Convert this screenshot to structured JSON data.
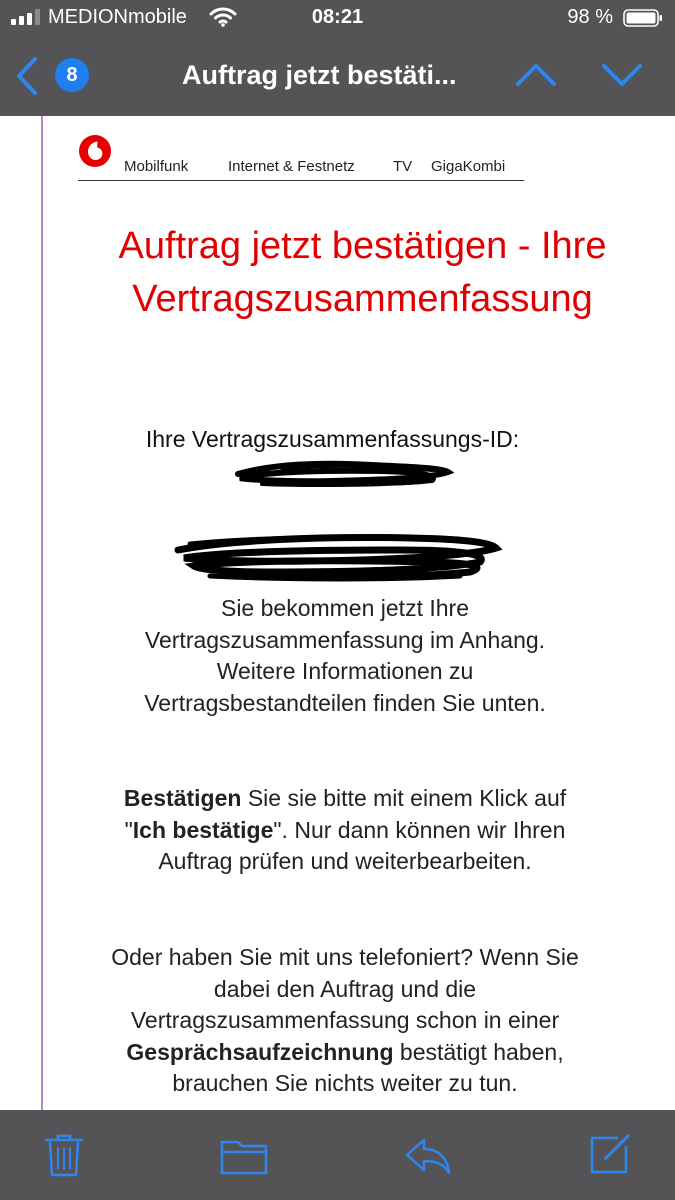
{
  "status_bar": {
    "carrier": "MEDIONmobile",
    "time": "08:21",
    "battery_percent": "98 %"
  },
  "nav": {
    "unread_count": "8",
    "title": "Auftrag jetzt bestäti..."
  },
  "email": {
    "brand_links": [
      "Mobilfunk",
      "Internet & Festnetz",
      "TV",
      "GigaKombi"
    ],
    "headline": "Auftrag jetzt bestätigen - Ihre Vertragszusammenfassung",
    "id_label": "Ihre Vertragszusammenfassungs-ID:",
    "paragraph1": "Sie bekommen jetzt Ihre Vertragszusammenfassung im Anhang. Weitere Informationen zu Vertragsbestandteilen finden Sie unten.",
    "paragraph2": {
      "bold1": "Bestätigen",
      "text1": " Sie sie bitte mit einem Klick auf \"",
      "bold2": "Ich bestätige",
      "text2": "\". Nur dann können wir Ihren Auftrag prüfen und weiterbearbeiten."
    },
    "paragraph3": {
      "text1": "Oder haben Sie mit uns telefoniert? Wenn Sie dabei den Auftrag und die Vertragszusammenfassung schon in einer ",
      "bold1": "Gesprächsaufzeichnung",
      "text2": " bestätigt haben, brauchen Sie nichts weiter zu tun."
    }
  },
  "colors": {
    "chrome": "#545456",
    "accent_blue": "#1f7ff0",
    "headline_red": "#e00000",
    "quote_bar": "#b987c9",
    "toolbar_icon": "#2e86f0"
  },
  "toolbar": {
    "icons": [
      "trash-icon",
      "folder-icon",
      "reply-icon",
      "compose-icon"
    ]
  }
}
